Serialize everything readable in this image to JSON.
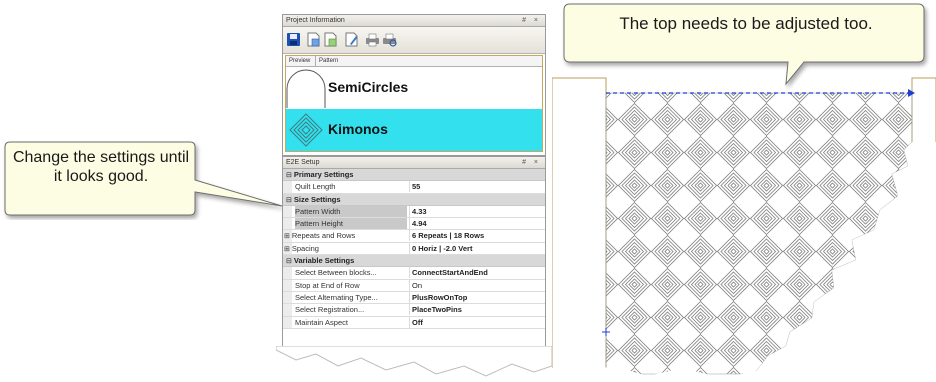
{
  "project_panel": {
    "title": "Project Information",
    "title_icons": "# ×",
    "toolbar": {
      "icons": [
        "save-icon",
        "add-pattern-icon",
        "open-pattern-icon",
        "edit-pattern-icon",
        "print-icon",
        "print-preview-icon"
      ]
    },
    "columns": [
      "Preview",
      "Pattern"
    ],
    "items": [
      {
        "name": "SemiCircles",
        "selected": false
      },
      {
        "name": "Kimonos",
        "selected": true
      }
    ]
  },
  "e2e_panel": {
    "title": "E2E Setup",
    "title_icons": "# ×",
    "rows": [
      {
        "type": "category",
        "label": "Primary Settings"
      },
      {
        "type": "prop",
        "label": "Quilt Length",
        "value": "55"
      },
      {
        "type": "category",
        "label": "Size Settings"
      },
      {
        "type": "prop",
        "label": "Pattern Width",
        "value": "4.33",
        "selected": true
      },
      {
        "type": "prop",
        "label": "Pattern Height",
        "value": "4.94",
        "selected": true
      },
      {
        "type": "prop",
        "label": "Repeats and Rows",
        "value": "6 Repeats | 18 Rows",
        "expandable": true
      },
      {
        "type": "prop",
        "label": "Spacing",
        "value": "0 Horiz | -2.0 Vert",
        "expandable": true
      },
      {
        "type": "category",
        "label": "Variable Settings"
      },
      {
        "type": "prop",
        "label": "Select Between blocks...",
        "value": "ConnectStartAndEnd"
      },
      {
        "type": "prop",
        "label": "Stop at End of Row",
        "value": "On"
      },
      {
        "type": "prop",
        "label": "Select Alternating Type...",
        "value": "PlusRowOnTop"
      },
      {
        "type": "prop",
        "label": "Select Registration...",
        "value": "PlaceTwoPins"
      },
      {
        "type": "prop",
        "label": "Maintain Aspect",
        "value": "Off"
      }
    ]
  },
  "callouts": {
    "left": "Change the settings until it looks good.",
    "top": "The top needs to be adjusted too."
  },
  "colors": {
    "selected_item": "#33e0ee",
    "callout_fill": "#fdfde3",
    "guide_line": "#1a3fd6",
    "pattern_stroke": "#7d7d7d"
  }
}
